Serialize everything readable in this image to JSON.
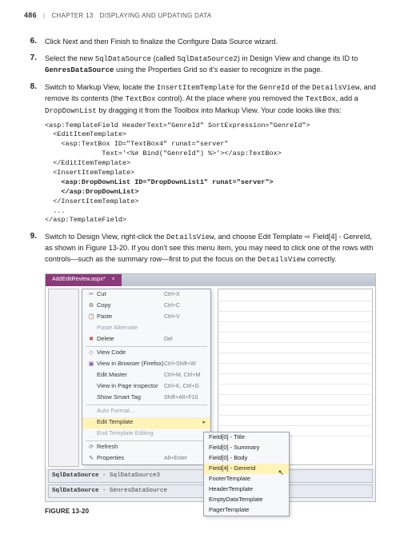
{
  "header": {
    "page_number": "486",
    "sep": "|",
    "chapter": "CHAPTER 13",
    "title": "DISPLAYING AND UPDATING DATA"
  },
  "steps": [
    {
      "n": "6.",
      "text": "Click Next and then Finish to finalize the Configure Data Source wizard."
    },
    {
      "n": "7.",
      "html": "Select the new <span class='code'>SqlDataSource</span> (called <span class='code'>SqlDataSource2</span>) in Design View and change its ID to <span class='code bold'>GenresDataSource</span> using the Properties Grid so it's easier to recognize in the page."
    },
    {
      "n": "8.",
      "html": "Switch to Markup View, locate the <span class='code'>InsertItemTemplate</span> for the <span class='code'>GenreId</span> of the <span class='code'>DetailsView</span>, and remove its contents (the <span class='code'>TextBox</span> control). At the place where you removed the <span class='code'>TextBox</span>, add a <span class='code'>DropDownList</span> by dragging it from the Toolbox into Markup View. Your code looks like this:"
    },
    {
      "n": "9.",
      "html": "Switch to Design View, right-click the <span class='code'>DetailsView</span>, and choose Edit Template ⇨ Field[4] - GenreId, as shown in Figure 13-20. If you don't see this menu item, you may need to click one of the rows with controls—such as the summary row—first to put the focus on the <span class='code'>DetailsView</span> correctly."
    }
  ],
  "code_lines": [
    "<asp:TemplateField HeaderText=\"GenreId\" SortExpression=\"GenreId\">",
    "  <EditItemTemplate>",
    "    <asp:TextBox ID=\"TextBox4\" runat=\"server\"",
    "              Text='<%# Bind(\"GenreId\") %>'></asp:TextBox>",
    "  </EditItemTemplate>",
    "  <InsertItemTemplate>",
    "    <asp:DropDownList ID=\"DropDownList1\" runat=\"server\">",
    "    </asp:DropDownList>",
    "  </InsertItemTemplate>",
    "  ...",
    "</asp:TemplateField>"
  ],
  "code_bold_idx": [
    6,
    7
  ],
  "figure": {
    "tab_label": "AddEditReview.aspx*",
    "menu": [
      {
        "icon": "ic-cut",
        "label": "Cut",
        "sc": "Ctrl+X"
      },
      {
        "icon": "ic-copy",
        "label": "Copy",
        "sc": "Ctrl+C"
      },
      {
        "icon": "ic-paste",
        "label": "Paste",
        "sc": "Ctrl+V"
      },
      {
        "icon": "",
        "label": "Paste Alternate",
        "sc": "",
        "dim": true
      },
      {
        "icon": "ic-del",
        "label": "Delete",
        "sc": "Del"
      },
      {
        "sep": true
      },
      {
        "icon": "ic-code",
        "label": "View Code",
        "sc": ""
      },
      {
        "icon": "ic-brw",
        "label": "View in Browser (Firefox)",
        "sc": "Ctrl+Shift+W"
      },
      {
        "icon": "",
        "label": "Edit Master",
        "sc": "Ctrl+M, Ctrl+M"
      },
      {
        "icon": "",
        "label": "View in Page Inspector",
        "sc": "Ctrl+K, Ctrl+G"
      },
      {
        "icon": "",
        "label": "Show Smart Tag",
        "sc": "Shift+Alt+F10"
      },
      {
        "sep": true
      },
      {
        "icon": "",
        "label": "Auto Format...",
        "sc": "",
        "dim": true
      },
      {
        "icon": "",
        "label": "Edit Template",
        "sc": "",
        "arrow": true,
        "highlight": true
      },
      {
        "icon": "",
        "label": "End Template Editing",
        "sc": "",
        "dim": true
      },
      {
        "sep": true
      },
      {
        "icon": "ic-ref",
        "label": "Refresh",
        "sc": ""
      },
      {
        "icon": "ic-prop",
        "label": "Properties",
        "sc": "Alt+Enter"
      }
    ],
    "submenu": [
      "Field[0] - Title",
      "Field[0] - Summary",
      "Field[0] - Body",
      "Field[4] - GenreId",
      "FooterTemplate",
      "HeaderTemplate",
      "EmptyDataTemplate",
      "PagerTemplate"
    ],
    "submenu_hl_idx": 3,
    "ds1": {
      "name": "SqlDataSource",
      "rest": " - SqlDataSource3"
    },
    "ds2": {
      "name": "SqlDataSource",
      "rest": " - GenresDataSource"
    },
    "caption": "FIGURE 13-20"
  }
}
